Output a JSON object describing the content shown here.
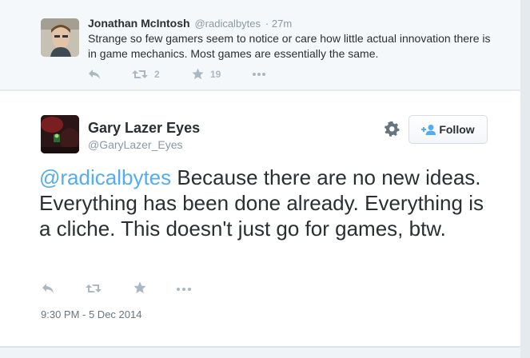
{
  "parent_tweet": {
    "name": "Jonathan McIntosh",
    "handle": "@radicalbytes",
    "time": "· 27m",
    "text": "Strange so few gamers seem to notice or care how little actual innovation there is in game mechanics. Most games are essentially the same.",
    "retweets": "2",
    "favorites": "19"
  },
  "main_tweet": {
    "name": "Gary Lazer Eyes",
    "handle": "@GaryLazer_Eyes",
    "follow_label": "Follow",
    "mention": "@radicalbytes",
    "text": " Because there are no new ideas. Everything has been done already. Everything is a cliche. This doesn't just go for games, btw.",
    "timestamp": "9:30 PM - 5 Dec 2014"
  },
  "icons": {
    "reply": "reply-icon",
    "retweet": "retweet-icon",
    "favorite": "star-icon",
    "more": "more-icon",
    "settings": "gear-icon",
    "follow": "add-person-icon"
  },
  "colors": {
    "link": "#55acee",
    "action_gray": "#aab8c2",
    "name_text": "#292f33",
    "muted_text": "#8899a6"
  }
}
